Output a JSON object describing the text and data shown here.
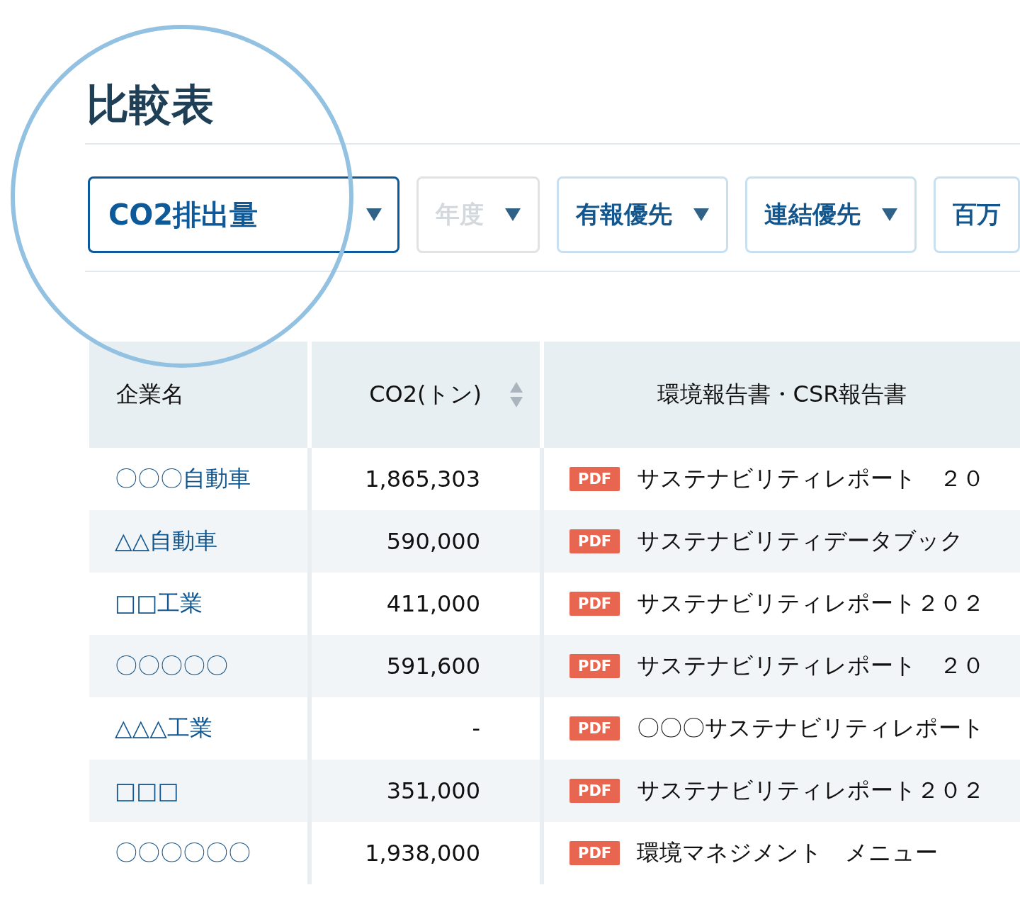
{
  "title": "比較表",
  "filters": [
    {
      "label": "CO2排出量",
      "active": true,
      "disabled": false,
      "caret": true
    },
    {
      "label": "年度",
      "active": false,
      "disabled": true,
      "caret": true
    },
    {
      "label": "有報優先",
      "active": false,
      "disabled": false,
      "caret": true
    },
    {
      "label": "連結優先",
      "active": false,
      "disabled": false,
      "caret": true
    },
    {
      "label": "百万",
      "active": false,
      "disabled": false,
      "caret": false
    }
  ],
  "table": {
    "columns": [
      {
        "label": "企業名",
        "sortable": false
      },
      {
        "label": "CO2(トン)",
        "sortable": true
      },
      {
        "label": "環境報告書・CSR報告書",
        "sortable": false
      }
    ],
    "rows": [
      {
        "company": "〇〇〇自動車",
        "co2": "1,865,303",
        "badge": "PDF",
        "report": "サステナビリティレポート　２０"
      },
      {
        "company": "△△自動車",
        "co2": "590,000",
        "badge": "PDF",
        "report": "サステナビリティデータブック"
      },
      {
        "company": "□□工業",
        "co2": "411,000",
        "badge": "PDF",
        "report": "サステナビリティレポート２０２"
      },
      {
        "company": "〇〇〇〇〇",
        "co2": "591,600",
        "badge": "PDF",
        "report": "サステナビリティレポート　２０"
      },
      {
        "company": "△△△工業",
        "co2": "-",
        "badge": "PDF",
        "report": "〇〇〇サステナビリティレポート"
      },
      {
        "company": "□□□",
        "co2": "351,000",
        "badge": "PDF",
        "report": "サステナビリティレポート２０２"
      },
      {
        "company": "〇〇〇〇〇〇",
        "co2": "1,938,000",
        "badge": "PDF",
        "report": "環境マネジメント　メニュー"
      }
    ]
  }
}
